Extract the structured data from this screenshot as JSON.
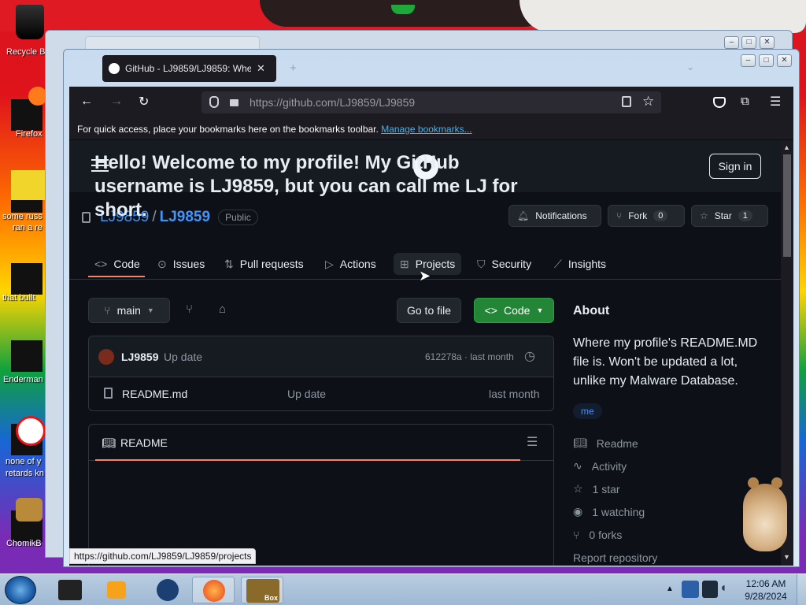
{
  "desktop": {
    "icons": [
      {
        "label": "Recycle B"
      },
      {
        "label": "Firefox"
      },
      {
        "label": "some russ"
      },
      {
        "label": "ran a re"
      },
      {
        "label": "that built"
      },
      {
        "label": "Enderman"
      },
      {
        "label": "none of y"
      },
      {
        "label": "retards kn"
      },
      {
        "label": "ChomikB"
      }
    ]
  },
  "browser": {
    "tab_title": "GitHub - LJ9859/LJ9859: Where",
    "url": "https://github.com/LJ9859/LJ9859",
    "bookmarks_text": "For quick access, place your bookmarks here on the bookmarks toolbar.",
    "manage_bookmarks": "Manage bookmarks...",
    "status_url": "https://github.com/LJ9859/LJ9859/projects"
  },
  "github": {
    "signin": "Sign in",
    "owner": "LJ9859",
    "separator": "/",
    "repo": "LJ9859",
    "visibility": "Public",
    "notifications": "Notifications",
    "fork": "Fork",
    "fork_count": "0",
    "star": "Star",
    "star_count": "1",
    "nav": [
      "Code",
      "Issues",
      "Pull requests",
      "Actions",
      "Projects",
      "Security",
      "Insights"
    ],
    "branch": "main",
    "go_to_file": "Go to file",
    "code_button": "Code",
    "commit_author": "LJ9859",
    "commit_message": "Up date",
    "commit_meta": "612278a · last month",
    "file_name": "README.md",
    "file_commit": "Up date",
    "file_time": "last month",
    "readme_label": "README",
    "readme_heading": "Hello! Welcome to my profile! My GitHub username is LJ9859, but you can call me LJ for short.",
    "about_title": "About",
    "about_text": "Where my profile's README.MD file is. Won't be updated a lot, unlike my Malware Database.",
    "topic": "me",
    "about_links": [
      "Readme",
      "Activity",
      "1 star",
      "1 watching",
      "0 forks",
      "Report repository"
    ]
  },
  "taskbar": {
    "time": "12:06 AM",
    "date": "9/28/2024",
    "box_label": "Box"
  }
}
